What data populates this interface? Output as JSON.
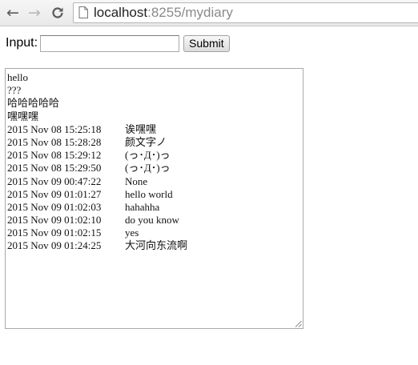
{
  "browser": {
    "url_host": "localhost",
    "url_rest": ":8255/mydiary",
    "back_icon": "back-arrow-icon",
    "forward_icon": "forward-arrow-icon",
    "reload_icon": "reload-icon"
  },
  "form": {
    "input_label": "Input:",
    "input_value": "",
    "input_placeholder": "",
    "submit_label": "Submit"
  },
  "diary": {
    "lines": [
      {
        "text": "hello"
      },
      {
        "text": "???"
      },
      {
        "text": "哈哈哈哈哈"
      },
      {
        "text": "嘿嘿嘿"
      },
      {
        "time": "2015 Nov 08 15:25:18",
        "text": "诶嘿嘿"
      },
      {
        "time": "2015 Nov 08 15:28:28",
        "text": "颜文字ノ"
      },
      {
        "time": "2015 Nov 08 15:29:12",
        "text": "(っ･Д･)っ"
      },
      {
        "time": "2015 Nov 08 15:29:50",
        "text": "(っ･Д･)っ"
      },
      {
        "time": "2015 Nov 09 00:47:22",
        "text": "None"
      },
      {
        "time": "2015 Nov 09 01:01:27",
        "text": "hello world"
      },
      {
        "time": "2015 Nov 09 01:02:03",
        "text": "hahahha"
      },
      {
        "time": "2015 Nov 09 01:02:10",
        "text": "do you know"
      },
      {
        "time": "2015 Nov 09 01:02:15",
        "text": "yes"
      },
      {
        "time": "2015 Nov 09 01:24:25",
        "text": "大河向东流啊"
      }
    ]
  }
}
